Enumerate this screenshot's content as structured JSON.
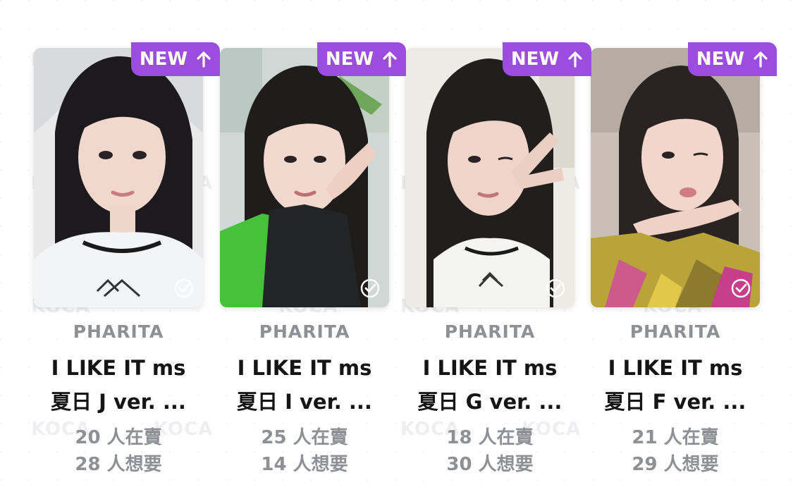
{
  "colors": {
    "badge": "#9b4de0",
    "artist_text": "#8e9096",
    "title_text": "#151515"
  },
  "watermark": "KOCA",
  "cards": [
    {
      "badge": "NEW",
      "artist": "PHARITA",
      "title_line1": "I LIKE IT ms",
      "title_line2": "夏日 J ver. ...",
      "selling": "20 人在賣",
      "wanting": "28 人想要"
    },
    {
      "badge": "NEW",
      "artist": "PHARITA",
      "title_line1": "I LIKE IT ms",
      "title_line2": "夏日 I ver. ...",
      "selling": "25 人在賣",
      "wanting": "14 人想要"
    },
    {
      "badge": "NEW",
      "artist": "PHARITA",
      "title_line1": "I LIKE IT ms",
      "title_line2": "夏日 G ver. ...",
      "selling": "18 人在賣",
      "wanting": "30 人想要"
    },
    {
      "badge": "NEW",
      "artist": "PHARITA",
      "title_line1": "I LIKE IT ms",
      "title_line2": "夏日 F ver. ...",
      "selling": "21 人在賣",
      "wanting": "29 人想要"
    }
  ]
}
